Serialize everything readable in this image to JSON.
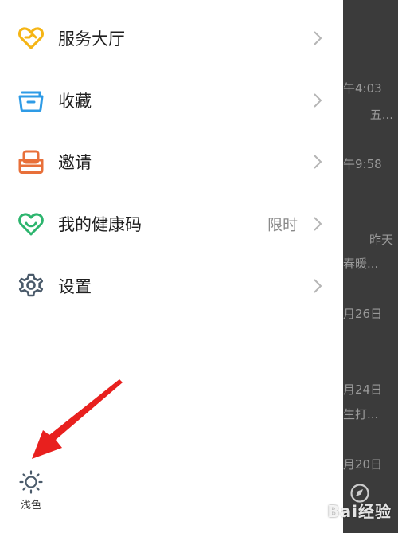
{
  "menu": {
    "items": [
      {
        "label": "服务大厅",
        "icon": "heart-hands-icon",
        "color": "#F5B515"
      },
      {
        "label": "收藏",
        "icon": "folder-box-icon",
        "color": "#2E9BE6"
      },
      {
        "label": "邀请",
        "icon": "inbox-icon",
        "color": "#E8703A"
      },
      {
        "label": "我的健康码",
        "icon": "smile-heart-icon",
        "color": "#2DB56E",
        "badge": "限时"
      },
      {
        "label": "设置",
        "icon": "gear-icon",
        "color": "#4A5A6A"
      }
    ]
  },
  "theme_toggle": {
    "label": "浅色",
    "icon": "sun-icon"
  },
  "background_list": {
    "times": [
      "午4:03",
      "午9:58",
      "昨天",
      "月26日",
      "月24日",
      "月20日"
    ],
    "snippets": [
      "五...",
      "春暖...",
      "生打..."
    ]
  },
  "watermark": "Bai经验",
  "colors": {
    "annotation_arrow": "#E8201E",
    "backdrop": "#3B3B3B"
  }
}
